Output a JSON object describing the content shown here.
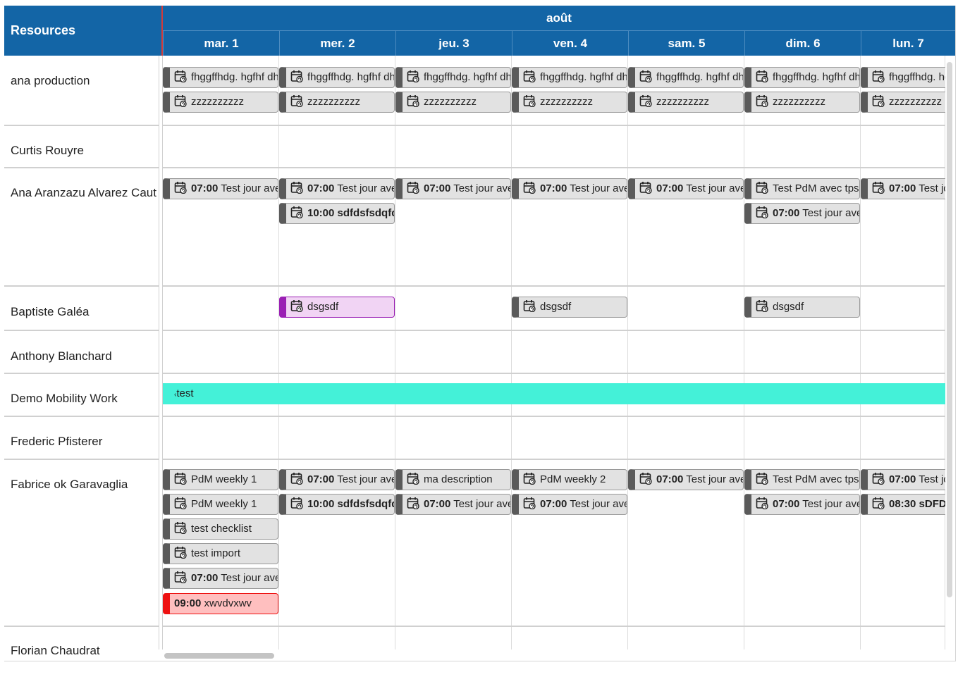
{
  "header": {
    "resources_label": "Resources",
    "month": "août",
    "days": [
      "mar. 1",
      "mer. 2",
      "jeu. 3",
      "ven. 4",
      "sam. 5",
      "dim. 6",
      "lun. 7"
    ]
  },
  "resources": [
    "ana production",
    "Curtis Rouyre",
    "Ana Aranzazu Alvarez Caut",
    "Baptiste Galéa",
    "Anthony Blanchard",
    "Demo Mobility Work",
    "Frederic Pfisterer",
    "Fabrice ok Garavaglia",
    "Florian Chaudrat"
  ],
  "events": {
    "fhgg": "fhggffhdg. hgfhf dh",
    "zzz": "zzzzzzzzzz",
    "time_0700": "07:00",
    "test_jour": "Test jour avec",
    "time_1000": "10:00",
    "sdfd": "sdfdsfsdqfdsq",
    "test_pdm": "Test PdM avec tps",
    "dsgsdf": "dsgsdf",
    "test": "test",
    "pdm_weekly_1": "PdM weekly 1",
    "pdm_weekly_2": "PdM weekly 2",
    "ma_description": "ma description",
    "test_checklist": "test checklist",
    "test_import": "test import",
    "time_0900": "09:00",
    "xwvdvxwv": "xwvdvxwv",
    "time_0830": "08:30",
    "sdfd2": "sDFDSF"
  },
  "colors": {
    "header_blue": "#1365a6",
    "event_default": "#e2e2e2",
    "event_purple": "#9a1fb4",
    "event_red": "#ee1111",
    "event_cyan": "#44f1d8",
    "today_marker": "#d23b3b"
  },
  "icons": {
    "event": "calendar-repeat-icon"
  }
}
